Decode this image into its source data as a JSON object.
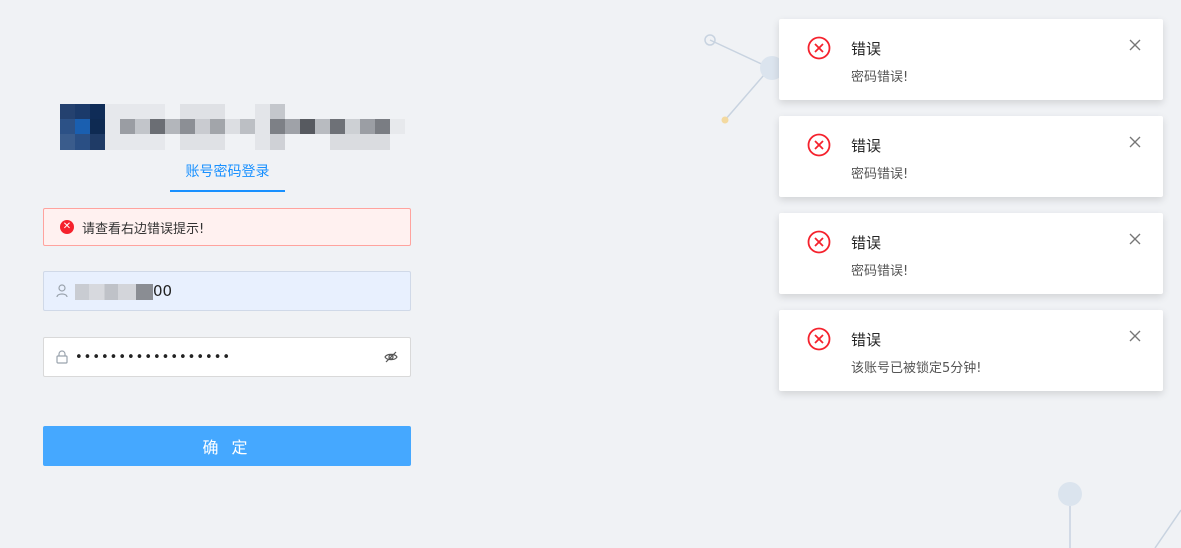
{
  "login": {
    "tab_label": "账号密码登录",
    "alert_icon": "close-circle-icon",
    "alert_text": "请查看右边错误提示!",
    "username": {
      "icon": "user-icon",
      "visible_suffix": "00"
    },
    "password": {
      "icon": "lock-icon",
      "masked_value": "••••••••••••••••••",
      "toggle_icon": "eye-invisible-icon"
    },
    "submit_label": "确 定"
  },
  "notifications": [
    {
      "title": "错误",
      "description": "密码错误!"
    },
    {
      "title": "错误",
      "description": "密码错误!"
    },
    {
      "title": "错误",
      "description": "密码错误!"
    },
    {
      "title": "错误",
      "description": "该账号已被锁定5分钟!"
    }
  ],
  "colors": {
    "primary": "#1890ff",
    "button": "#45a8ff",
    "error": "#f5222d",
    "background": "#f0f2f5"
  }
}
